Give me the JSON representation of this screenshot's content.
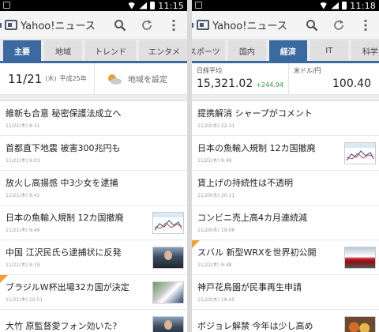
{
  "left": {
    "time": "11:15",
    "app_title": "Yahoo!ニュース",
    "tabs": [
      "主要",
      "地域",
      "トレンド",
      "エンタメ"
    ],
    "date": {
      "main": "11/21",
      "weekday": "(木)",
      "era": "平成25年"
    },
    "weather_label": "地域を設定",
    "news": [
      {
        "title": "維新も合意 秘密保護法成立へ",
        "date": "11/21(木) 8:31"
      },
      {
        "title": "首都直下地震 被害300兆円も",
        "date": "11/21(木) 9:03"
      },
      {
        "title": "放火し高揚感 中3少女を逮捕",
        "date": "11/21(木) 9:41"
      },
      {
        "title": "日本の魚輸入規制 12カ国撤廃",
        "date": "11/21(木) 9:49"
      },
      {
        "title": "中国 江沢民氏ら逮捕状に反発",
        "date": "11/21(木) 9:19"
      },
      {
        "title": "ブラジルW杯出場32カ国が決定",
        "date": "11/21(木) 10:51"
      },
      {
        "title": "大竹 原監督愛フォン効いた?",
        "date": ""
      }
    ]
  },
  "right": {
    "time": "11:18",
    "app_title": "Yahoo!ニュース",
    "tabs": [
      "スポーツ",
      "国内",
      "経済",
      "IT",
      "科学"
    ],
    "finance": {
      "nikkei_label": "日経平均",
      "nikkei_value": "15,321.02",
      "nikkei_change": "+244.94",
      "usdjpy_label": "米ドル/円",
      "usdjpy_value": "100.40"
    },
    "news": [
      {
        "title": "提携解消 シャープがコメント",
        "date": "11/20(水) 22:31"
      },
      {
        "title": "日本の魚輸入規制 12カ国撤廃",
        "date": "11/21(木) 9:49"
      },
      {
        "title": "賃上げの持続性は不透明",
        "date": "11/20(水) 20:11"
      },
      {
        "title": "コンビニ売上高4カ月連続減",
        "date": "11/20(水) 19:08"
      },
      {
        "title": "スバル 新型WRXを世界初公開",
        "date": "11/21(木) 9:48"
      },
      {
        "title": "神戸花鳥園が民事再生申請",
        "date": "11/20(水) 18:45"
      },
      {
        "title": "ボジョレ解禁 今年は少し高め",
        "date": ""
      }
    ]
  }
}
